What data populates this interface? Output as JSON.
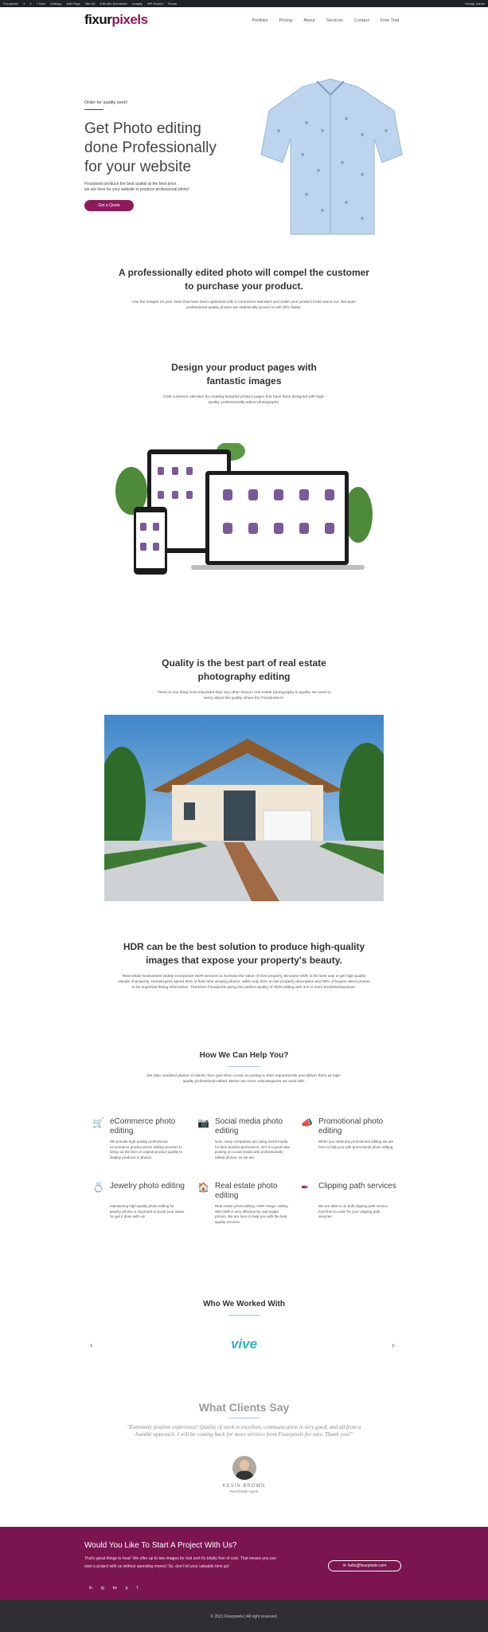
{
  "adminbar": {
    "items": [
      "Fixurpixels",
      "3",
      "0",
      "+ New",
      "Settings",
      "Edit Page",
      "Site Kit",
      "Edit with Elementor",
      "Imagify",
      "WP Rocket",
      "Forms"
    ],
    "right": "Howdy, admin"
  },
  "nav": {
    "logo_a": "fixur",
    "logo_b": "pixels",
    "menu": [
      "Portfolio",
      "Pricing",
      "About",
      "Services",
      "Contact",
      "Free Trial"
    ]
  },
  "hero": {
    "small": "Order for quality work!",
    "title": "Get Photo editing done Professionally for your website",
    "desc_line1": "Fixurpixels produce the best quality at the best price.",
    "desc_line2": "we are here for your website to produce professional photo!",
    "button": "Get a Quote"
  },
  "s1": {
    "title": "A professionally edited photo will compel the customer to purchase your product.",
    "desc": "Use the images on your store that have been optimized with e-commerce standard and make your product looks stand out. Because professional quality photos are statistically proven to sell 30% faster."
  },
  "s2": {
    "title": "Design your product pages with fantastic images",
    "desc": "Grab customer attention by creating beautiful product pages that have been designed with high-quality, professionally edited photographs."
  },
  "s3": {
    "title": "Quality is the best part of real estate photography editing",
    "desc": "There is one thing most important than any other thing in real estate photography is quality. No need to worry about the quality where the Fixurpixels is."
  },
  "s4": {
    "title": "HDR can be the best solution to produce high-quality images that expose your property's beauty.",
    "desc": "Real estate businesses widely incorporate HDR services to increase the value of their property. Because HDR is the best way to get high quality visuals of property. Homebuyers spend 80% of their time viewing photos, while only 20% on the property description and 83% of buyers deem photos to be important listing information. Therefore Fixurpixels giving the perfect quality of HDR editing with 3-5 or more brackets/exposure."
  },
  "help": {
    "title": "How We Can Help You?",
    "desc": "We take unedited photos of clients, then give them a look according to their requirements and deliver them as high-quality professional edited. Below are some subcategories we work with.",
    "services": [
      {
        "title": "eCommerce photo editing",
        "desc": "We provide high-quality professional eCommerce product photo editing services to bring out the face of original product quality to display products to photos."
      },
      {
        "title": "Social media photo editing",
        "desc": "Now, many companies are using social media for their product promotions. Isn't it a good idea posting on social media with professionally edited photos, so we are."
      },
      {
        "title": "Promotional photo editing",
        "desc": "When you need any promotional editing we are here to help you with promotional photo editing."
      },
      {
        "title": "Jewelry photo editing",
        "desc": "Maintaining high-quality photo editing for jewelry photos is important to boost your sales! So get it done with us!"
      },
      {
        "title": "Real estate photo editing",
        "desc": "Real estate photo editing, HDR merge, editing with HDR is very effective for real estate photos. We are here to help you with the best quality services."
      },
      {
        "title": "Clipping path services",
        "desc": "We are able to do bulk clipping path service. Feel free to order for your clipping path services."
      }
    ]
  },
  "partners": {
    "title": "Who We Worked With",
    "logo": "vive"
  },
  "testimonials": {
    "title": "What Clients Say",
    "quote": "\"Extremely positive experience! Quality of work is excellent, communication is very good, and all from a humble approach. I will be coming back for more services from Fixurpixels for sure. Thank you!\"",
    "name": "KEVIN BROWN",
    "role": "Real Estate Agent"
  },
  "footer": {
    "cta_title": "Would You Like To Start A Project With Us?",
    "cta_line1": "That's great things to hear! We offer up to two images for trial and it's totally free of cost. That means you can",
    "cta_line2": "start a project with us without spending money! So, don't let your valuable time go!",
    "email": "hello@fixurpixels.com",
    "social": [
      "in",
      "ig",
      "tw",
      "p",
      "f"
    ],
    "copyright": "© 2021 Fixurpixels | All right reserved."
  },
  "colors": {
    "brand": "#8e1a5a",
    "footer": "#7a1550",
    "bottom": "#2e2e33"
  }
}
